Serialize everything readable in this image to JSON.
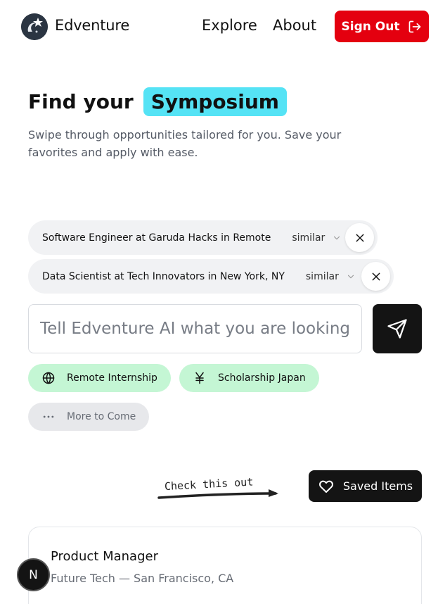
{
  "header": {
    "brand": "Edventure",
    "nav": {
      "explore": "Explore",
      "about": "About"
    },
    "sign_out_label": "Sign Out"
  },
  "hero": {
    "title_prefix": "Find your",
    "title_highlight": "Symposium",
    "subtitle": "Swipe through opportunities tailored for you. Save your favorites and apply with ease."
  },
  "filters": [
    {
      "label": "Software Engineer at Garuda Hacks in Remote",
      "mode": "similar"
    },
    {
      "label": "Data Scientist at Tech Innovators in New York, NY",
      "mode": "similar"
    }
  ],
  "search": {
    "placeholder": "Tell Edventure AI what you are looking for"
  },
  "suggestions": [
    {
      "label": "Remote Internship",
      "icon": "globe-icon"
    },
    {
      "label": "Scholarship Japan",
      "icon": "yen-icon"
    },
    {
      "label": "More to Come",
      "icon": "ellipsis-icon"
    }
  ],
  "annotation": {
    "text": "Check this out"
  },
  "saved": {
    "label": "Saved Items"
  },
  "card": {
    "title": "Product Manager",
    "subtitle": "Future Tech — San Francisco, CA"
  },
  "badge": {
    "letter": "N"
  },
  "colors": {
    "accent_red": "#e4000f",
    "highlight_cyan": "#55e3f5",
    "suggestion_green": "#c4f6d4",
    "dark": "#141414"
  }
}
